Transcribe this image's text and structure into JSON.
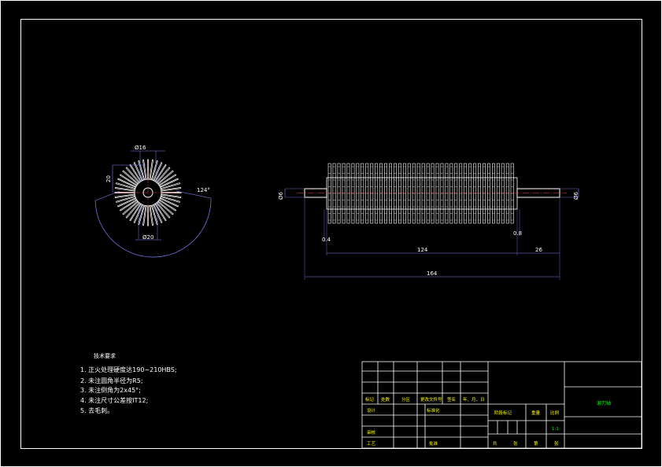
{
  "drawing": {
    "left_view": {
      "dia_top": "Ø16",
      "height": "20",
      "dia_bottom": "Ø20",
      "angle": "124°"
    },
    "main_view": {
      "dia_left": "Ø6",
      "dia_right": "Ø6",
      "chamfer_left": "0.4",
      "chamfer_right": "0.8",
      "len_body": "124",
      "len_shaft": "26",
      "len_total": "164"
    }
  },
  "notes": {
    "title": "技术要求",
    "items": [
      "1. 正火处理硬度达190~210HBS;",
      "2. 未注圆角半径为R5;",
      "3. 未注倒角为2x45°;",
      "4. 未注尺寸公差按IT12;",
      "5. 去毛刺。"
    ]
  },
  "title_block": {
    "row_labels": [
      "标记",
      "处数",
      "分区",
      "更改文件号",
      "签名",
      "年、月、日"
    ],
    "designer": "设计",
    "standardization": "标准化",
    "reviewer": "审核",
    "process": "工艺",
    "approve": "批准",
    "stage_mark": "阶段标记",
    "weight": "重量",
    "scale": "比例",
    "scale_value": "1:1",
    "sheets": [
      "共",
      "张",
      "第",
      "张"
    ],
    "drawing_name": "滚刀轴"
  },
  "colors": {
    "background": "#000000",
    "lines": "#ffffff",
    "dimension": "#8080ff",
    "text_yellow": "#ffff00",
    "text_green": "#00ff00"
  }
}
